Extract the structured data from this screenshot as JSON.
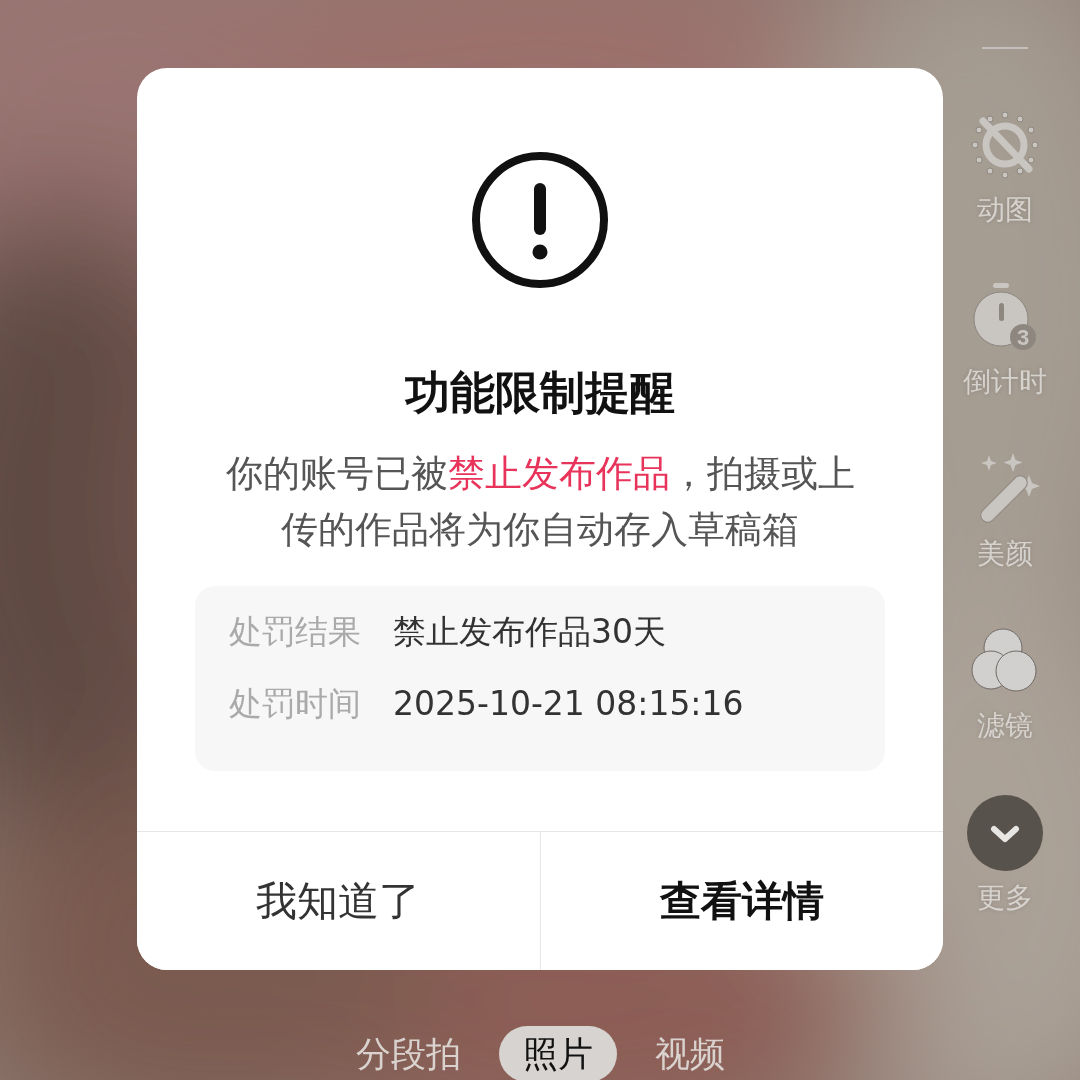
{
  "sidebar": {
    "items": [
      {
        "label": "动图"
      },
      {
        "label": "倒计时",
        "badge": "3"
      },
      {
        "label": "美颜"
      },
      {
        "label": "滤镜"
      },
      {
        "label": "更多"
      }
    ]
  },
  "dialog": {
    "title": "功能限制提醒",
    "message": [
      {
        "text": "你的账号已被",
        "highlighted": false
      },
      {
        "text": "禁止发布作品",
        "highlighted": true
      },
      {
        "text": "，拍摄或上传的作品将为你自动存入草稿箱",
        "highlighted": false
      }
    ],
    "details": [
      {
        "label": "处罚结果",
        "value": "禁止发布作品30天"
      },
      {
        "label": "处罚时间",
        "value": "2025-10-21 08:15:16"
      }
    ],
    "buttons": [
      {
        "label": "我知道了",
        "primary": false
      },
      {
        "label": "查看详情",
        "primary": true
      }
    ]
  },
  "modes": [
    {
      "label": "分段拍",
      "selected": false
    },
    {
      "label": "照片",
      "selected": true
    },
    {
      "label": "视频",
      "selected": false
    }
  ]
}
